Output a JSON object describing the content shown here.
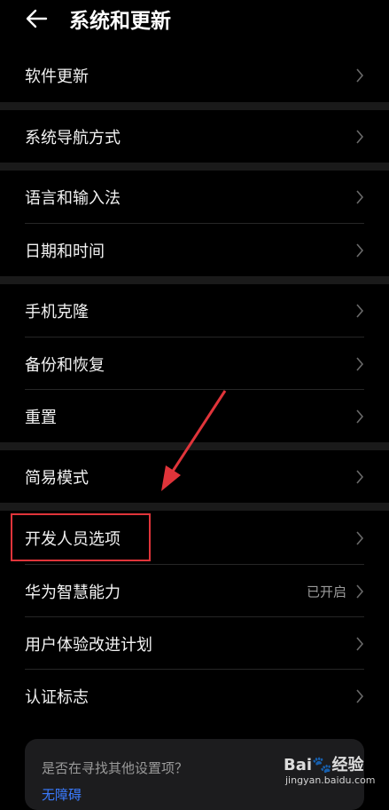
{
  "header": {
    "title": "系统和更新",
    "back_icon": "arrow-left-icon"
  },
  "items": [
    {
      "label": "软件更新"
    },
    {
      "label": "系统导航方式"
    },
    {
      "label": "语言和输入法"
    },
    {
      "label": "日期和时间"
    },
    {
      "label": "手机克隆"
    },
    {
      "label": "备份和恢复"
    },
    {
      "label": "重置"
    },
    {
      "label": "简易模式"
    },
    {
      "label": "开发人员选项"
    },
    {
      "label": "华为智慧能力",
      "status": "已开启"
    },
    {
      "label": "用户体验改进计划"
    },
    {
      "label": "认证标志"
    }
  ],
  "card": {
    "question": "是否在寻找其他设置项？",
    "link": "无障碍"
  },
  "annotation": {
    "highlight_color": "#e0343a",
    "arrow_color": "#e0343a"
  },
  "watermark": {
    "logo": "Bai🐾经验",
    "url": "jingyan.baidu.com"
  }
}
